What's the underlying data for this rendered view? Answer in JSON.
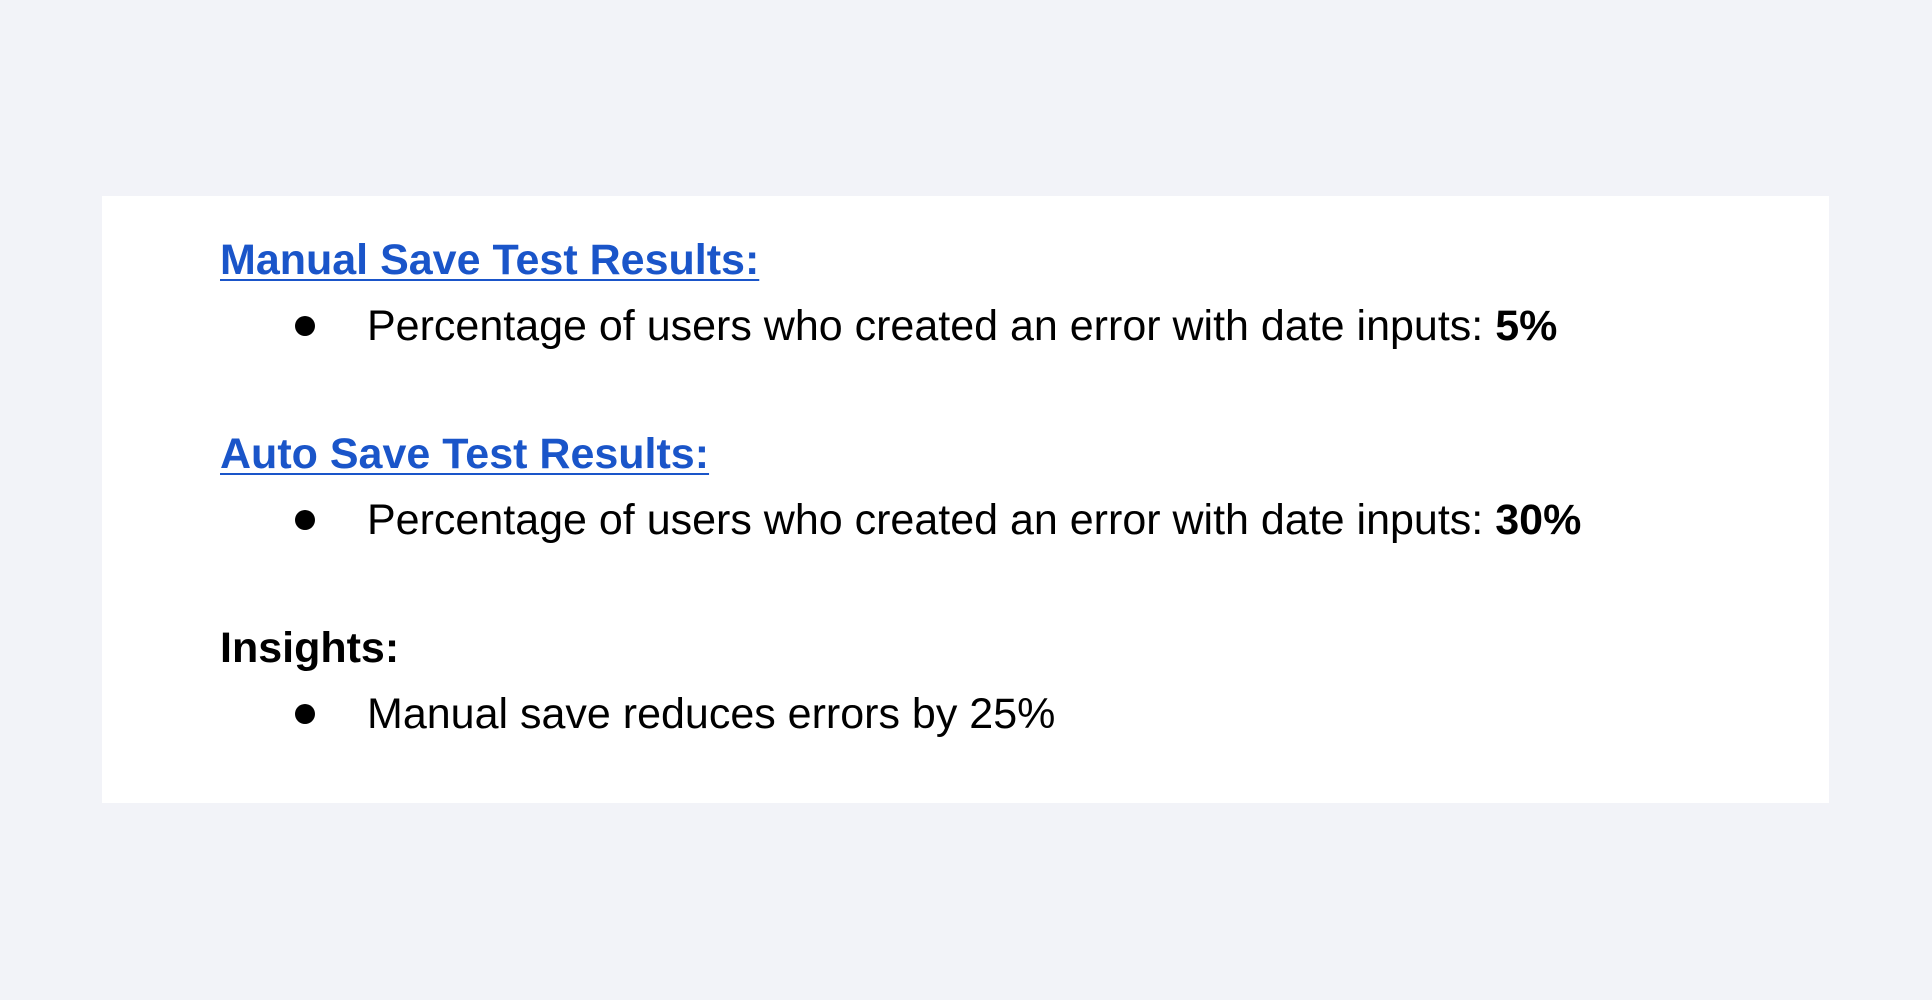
{
  "sections": [
    {
      "heading": "Manual Save Test Results:",
      "bullet_text": "Percentage of users who created an error with date inputs:",
      "bullet_value": "5%"
    },
    {
      "heading": "Auto Save Test Results:",
      "bullet_text": "Percentage of users who created an error with date inputs:",
      "bullet_value": "30%"
    },
    {
      "heading": "Insights:",
      "bullet_text": "Manual save reduces errors by 25%",
      "bullet_value": ""
    }
  ],
  "colors": {
    "page_background": "#f2f3f8",
    "card_background": "#ffffff",
    "link_heading": "#1a55c9",
    "text": "#000000"
  }
}
